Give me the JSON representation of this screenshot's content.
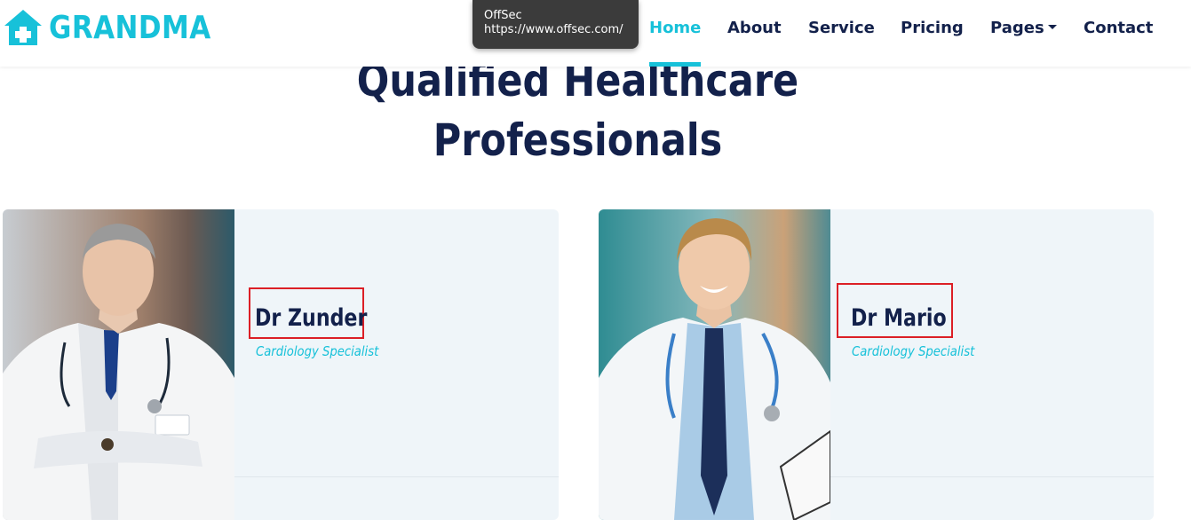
{
  "brand": {
    "name": "GRANDMA",
    "icon": "house-medical-icon",
    "color": "#17c1d9"
  },
  "nav": {
    "items": [
      {
        "label": "Home",
        "active": true
      },
      {
        "label": "About",
        "active": false
      },
      {
        "label": "Service",
        "active": false
      },
      {
        "label": "Pricing",
        "active": false
      },
      {
        "label": "Pages",
        "active": false,
        "dropdown": true
      },
      {
        "label": "Contact",
        "active": false
      }
    ]
  },
  "tooltip": {
    "title": "OffSec",
    "url": "https://www.offsec.com/"
  },
  "section": {
    "title_line1": "Qualified Healthcare",
    "title_line2": "Professionals"
  },
  "team": [
    {
      "name": "Dr Zunder",
      "role": "Cardiology Specialist",
      "photo": "doctor-photo-senior"
    },
    {
      "name": "Dr Mario",
      "role": "Cardiology Specialist",
      "photo": "doctor-photo-young"
    }
  ],
  "colors": {
    "accent": "#17c1d9",
    "dark": "#13214b",
    "card_bg": "#eff5f9",
    "highlight": "#dc1f26"
  }
}
